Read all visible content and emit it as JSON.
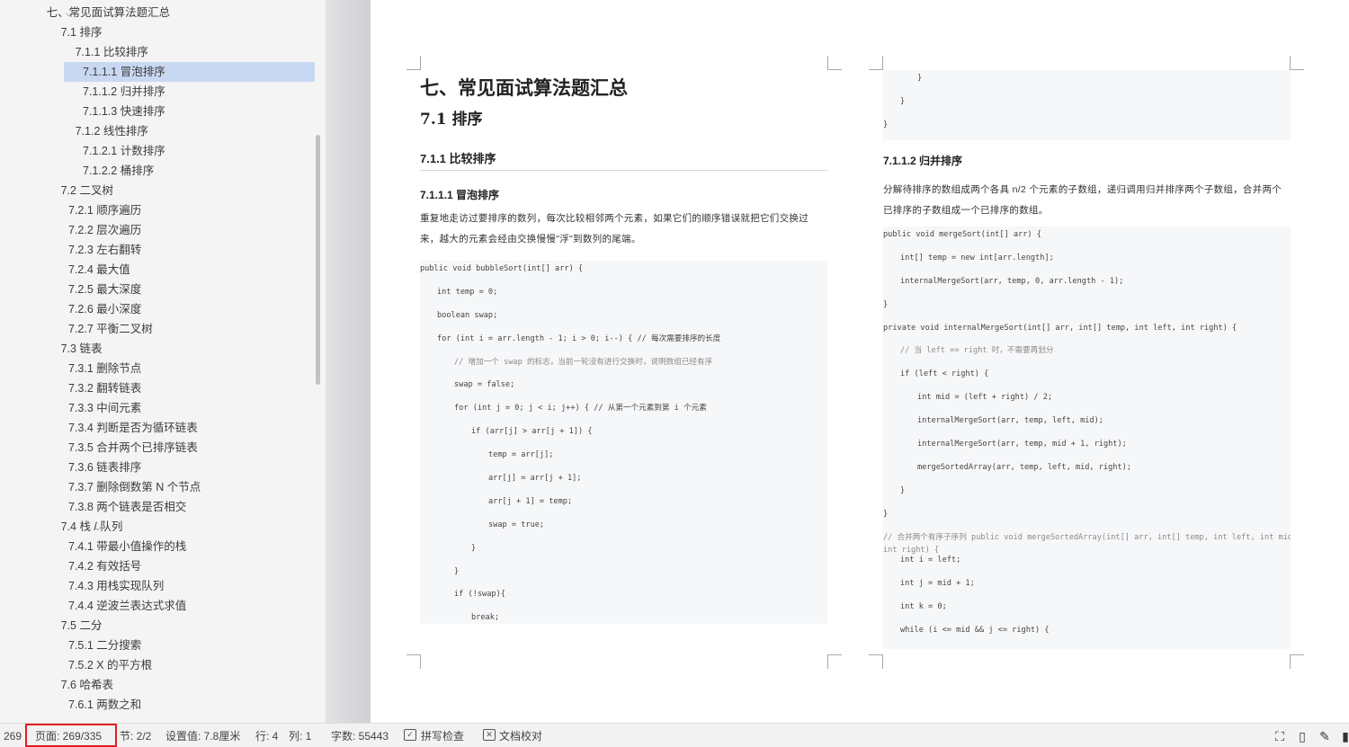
{
  "nav": {
    "items": [
      {
        "label": "七、常见面试算法题汇总",
        "level": 0,
        "expanded": true
      },
      {
        "label": "7.1  排序",
        "level": 1,
        "expanded": true
      },
      {
        "label": "7.1.1  比较排序",
        "level": 2,
        "expanded": true
      },
      {
        "label": "7.1.1.1  冒泡排序",
        "level": 3,
        "selected": true
      },
      {
        "label": "7.1.1.2  归并排序",
        "level": 3
      },
      {
        "label": "7.1.1.3  快速排序",
        "level": 3
      },
      {
        "label": "7.1.2  线性排序",
        "level": 2,
        "expanded": true
      },
      {
        "label": "7.1.2.1  计数排序",
        "level": 3
      },
      {
        "label": "7.1.2.2  桶排序",
        "level": 3
      },
      {
        "label": "7.2  二叉树",
        "level": 1,
        "expanded": true
      },
      {
        "label": "7.2.1  顺序遍历",
        "level": 2
      },
      {
        "label": "7.2.2  层次遍历",
        "level": 2
      },
      {
        "label": "7.2.3  左右翻转",
        "level": 2
      },
      {
        "label": "7.2.4  最大值",
        "level": 2
      },
      {
        "label": "7.2.5  最大深度",
        "level": 2
      },
      {
        "label": "7.2.6  最小深度",
        "level": 2
      },
      {
        "label": "7.2.7  平衡二叉树",
        "level": 2
      },
      {
        "label": "7.3  链表",
        "level": 1,
        "expanded": true
      },
      {
        "label": "7.3.1  删除节点",
        "level": 2
      },
      {
        "label": "7.3.2  翻转链表",
        "level": 2
      },
      {
        "label": "7.3.3  中间元素",
        "level": 2
      },
      {
        "label": "7.3.4  判断是否为循环链表",
        "level": 2
      },
      {
        "label": "7.3.5  合并两个已排序链表",
        "level": 2
      },
      {
        "label": "7.3.6  链表排序",
        "level": 2
      },
      {
        "label": "7.3.7  删除倒数第 N 个节点",
        "level": 2
      },
      {
        "label": "7.3.8  两个链表是否相交",
        "level": 2
      },
      {
        "label": "7.4  栈 / 队列",
        "level": 1,
        "expanded": true
      },
      {
        "label": "7.4.1  带最小值操作的栈",
        "level": 2
      },
      {
        "label": "7.4.2  有效括号",
        "level": 2
      },
      {
        "label": "7.4.3  用栈实现队列",
        "level": 2
      },
      {
        "label": "7.4.4  逆波兰表达式求值",
        "level": 2
      },
      {
        "label": "7.5  二分",
        "level": 1,
        "expanded": true
      },
      {
        "label": "7.5.1  二分搜索",
        "level": 2
      },
      {
        "label": "7.5.2 X 的平方根",
        "level": 2
      },
      {
        "label": "7.6  哈希表",
        "level": 1,
        "expanded": true
      },
      {
        "label": "7.6.1  两数之和",
        "level": 2
      }
    ]
  },
  "page1": {
    "h1": "七、常见面试算法题汇总",
    "h2": "7.1  排序",
    "h3": "7.1.1  比较排序",
    "h4": "7.1.1.1  冒泡排序",
    "para": "重复地走访过要排序的数列，每次比较相邻两个元素，如果它们的顺序错误就把它们交换过来，越大的元素会经由交换慢慢\"浮\"到数列的尾端。",
    "code": [
      {
        "indent": 0,
        "text": "public void bubbleSort(int[] arr) {"
      },
      {
        "indent": 1,
        "text": "int temp = 0;"
      },
      {
        "indent": 1,
        "text": "boolean swap;"
      },
      {
        "indent": 1,
        "text": "for (int i = arr.length - 1; i > 0; i--) { // 每次需要排序的长度"
      },
      {
        "indent": 2,
        "text": "// 增加一个 swap 的标志，当前一轮没有进行交换时，说明数组已经有序"
      },
      {
        "indent": 2,
        "text": "swap = false;"
      },
      {
        "indent": 2,
        "text": "for (int j = 0; j < i; j++) { // 从第一个元素到第 i 个元素"
      },
      {
        "indent": 3,
        "text": "if (arr[j] > arr[j + 1]) {"
      },
      {
        "indent": 4,
        "text": "temp = arr[j];"
      },
      {
        "indent": 4,
        "text": "arr[j] = arr[j + 1];"
      },
      {
        "indent": 4,
        "text": "arr[j + 1] = temp;"
      },
      {
        "indent": 4,
        "text": "swap = true;"
      },
      {
        "indent": 3,
        "text": "}"
      },
      {
        "indent": 2,
        "text": "}"
      },
      {
        "indent": 2,
        "text": "if (!swap){"
      },
      {
        "indent": 3,
        "text": "break;"
      }
    ]
  },
  "page2": {
    "top_code": [
      {
        "indent": 2,
        "text": "}"
      },
      {
        "indent": 1,
        "text": "}"
      },
      {
        "indent": 0,
        "text": "}"
      }
    ],
    "h4": "7.1.1.2  归并排序",
    "para": "分解待排序的数组成两个各具  n/2  个元素的子数组，递归调用归并排序两个子数组，合并两个已排序的子数组成一个已排序的数组。",
    "code": [
      {
        "indent": 0,
        "text": "public void mergeSort(int[] arr) {"
      },
      {
        "indent": 1,
        "text": "int[] temp = new int[arr.length];"
      },
      {
        "indent": 1,
        "text": "internalMergeSort(arr, temp, 0, arr.length - 1);"
      },
      {
        "indent": 0,
        "text": "}"
      },
      {
        "indent": 0,
        "text": "private void internalMergeSort(int[] arr, int[] temp, int left, int right) {"
      },
      {
        "indent": 1,
        "text": "// 当 left == right 时，不需要再划分"
      },
      {
        "indent": 1,
        "text": "if (left < right) {"
      },
      {
        "indent": 2,
        "text": "int mid = (left + right) / 2;"
      },
      {
        "indent": 2,
        "text": "internalMergeSort(arr, temp, left, mid);"
      },
      {
        "indent": 2,
        "text": "internalMergeSort(arr, temp, mid + 1, right);"
      },
      {
        "indent": 2,
        "text": "mergeSortedArray(arr, temp, left, mid, right);"
      },
      {
        "indent": 1,
        "text": "}"
      },
      {
        "indent": 0,
        "text": "}"
      },
      {
        "indent": 0,
        "text": "// 合并两个有序子序列 public void mergeSortedArray(int[] arr, int[] temp, int left, int mid,\nint right) {"
      },
      {
        "indent": 1,
        "text": "int i = left;"
      },
      {
        "indent": 1,
        "text": "int j = mid + 1;"
      },
      {
        "indent": 1,
        "text": "int k = 0;"
      },
      {
        "indent": 1,
        "text": "while (i <= mid && j <= right) {"
      }
    ]
  },
  "status": {
    "page_num": "269",
    "page": "页面: 269/335",
    "section": "节: 2/2",
    "setting": "设置值: 7.8厘米",
    "row": "行: 4",
    "col": "列: 1",
    "words": "字数: 55443",
    "spell": "拼写检查",
    "proof": "文档校对"
  },
  "colors": {
    "selection": "#c9d8f2",
    "highlight_box": "#e02020",
    "keyword": "#b5428c"
  }
}
